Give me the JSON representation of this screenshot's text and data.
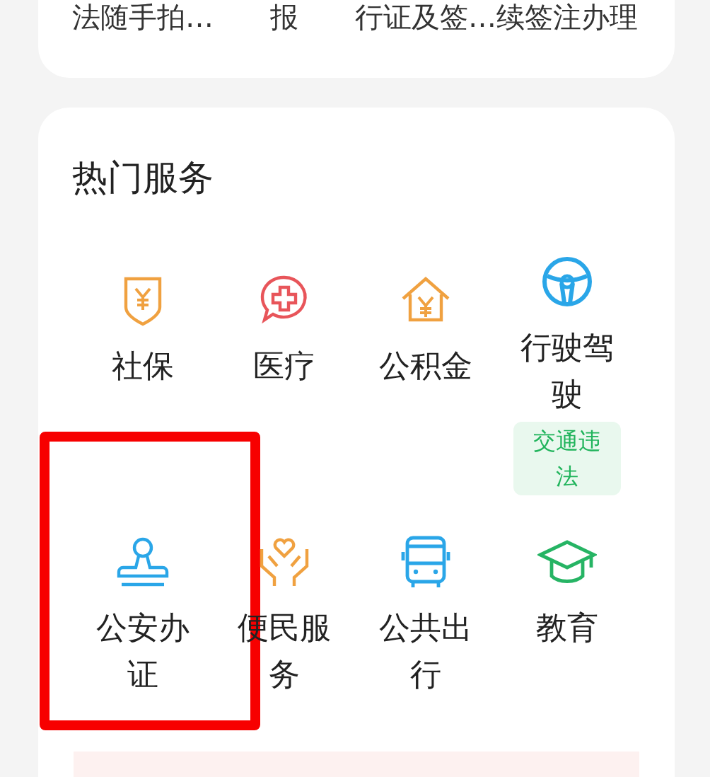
{
  "top_card": {
    "items": [
      "法随手拍…",
      "报",
      "行证及签…",
      "续签注办理"
    ]
  },
  "hot_services": {
    "title": "热门服务",
    "rows": [
      [
        {
          "label": "社保",
          "highlighted": false
        },
        {
          "label": "医疗",
          "highlighted": false
        },
        {
          "label": "公积金",
          "highlighted": false
        },
        {
          "label": "行驶驾驶",
          "highlighted": false,
          "tag": "交通违法"
        }
      ],
      [
        {
          "label": "公安办证",
          "highlighted": true
        },
        {
          "label": "便民服务",
          "highlighted": false
        },
        {
          "label": "公共出行",
          "highlighted": false
        },
        {
          "label": "教育",
          "highlighted": false
        }
      ]
    ]
  }
}
